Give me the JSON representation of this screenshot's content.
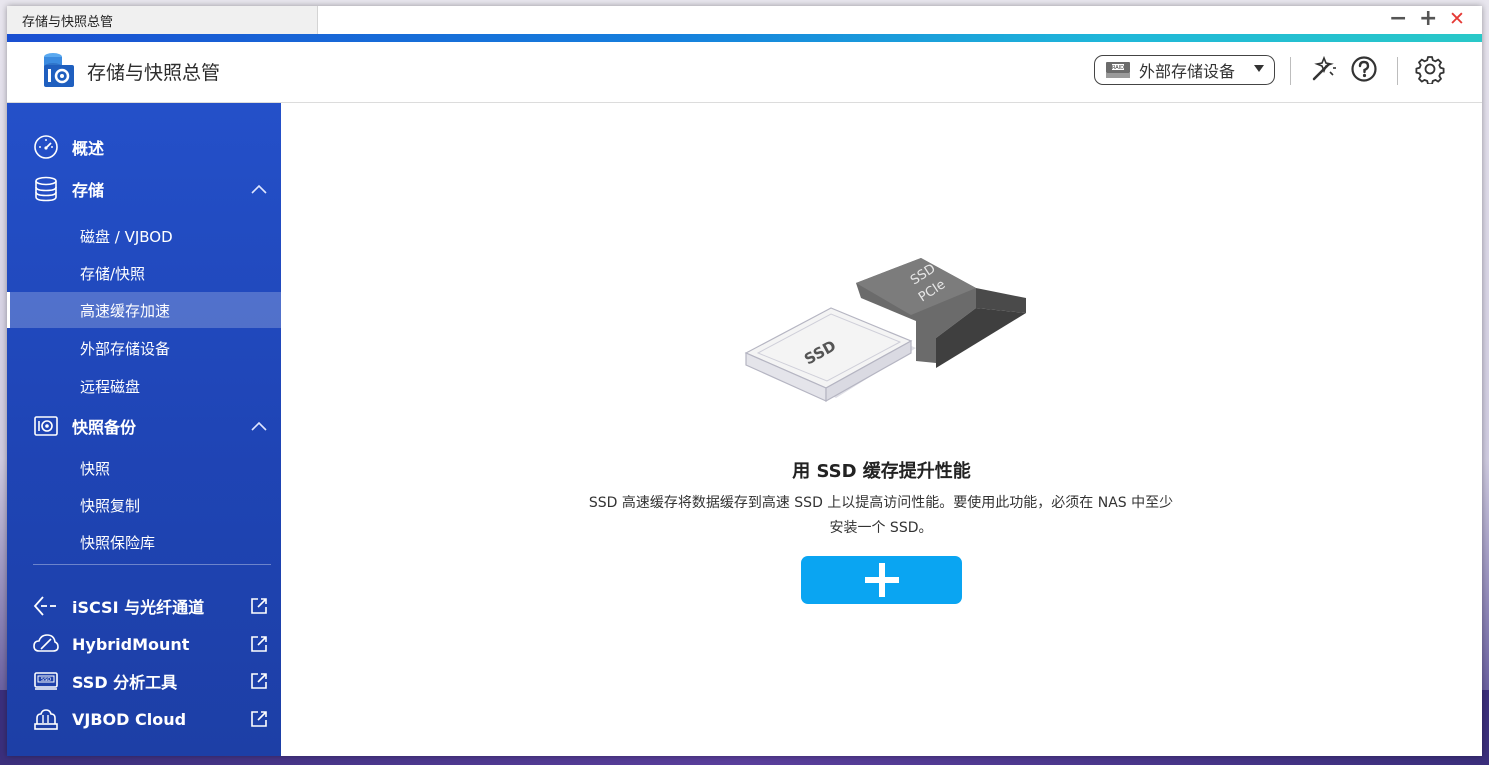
{
  "window": {
    "tab_title": "存储与快照总管",
    "controls": {
      "minimize": "−",
      "maximize": "+",
      "close": "✕"
    }
  },
  "header": {
    "app_title": "存储与快照总管",
    "device_selector": {
      "value": "外部存储设备",
      "icon": "raid-icon"
    },
    "icons": [
      "magic-wand-icon",
      "help-icon",
      "settings-icon"
    ]
  },
  "sidebar": {
    "items": [
      {
        "label": "概述",
        "icon": "dashboard-icon"
      },
      {
        "label": "存储",
        "icon": "database-icon",
        "expanded": true
      },
      {
        "label": "磁盘 / VJBOD"
      },
      {
        "label": "存储/快照"
      },
      {
        "label": "高速缓存加速",
        "selected": true
      },
      {
        "label": "外部存储设备"
      },
      {
        "label": "远程磁盘"
      },
      {
        "label": "快照备份",
        "icon": "camera-icon",
        "expanded": true
      },
      {
        "label": "快照"
      },
      {
        "label": "快照复制"
      },
      {
        "label": "快照保险库"
      }
    ],
    "external_links": [
      {
        "label": "iSCSI 与光纤通道",
        "icon": "iscsi-icon"
      },
      {
        "label": "HybridMount",
        "icon": "cloud-icon"
      },
      {
        "label": "SSD 分析工具",
        "icon": "ssd-icon"
      },
      {
        "label": "VJBOD Cloud",
        "icon": "vjbod-cloud-icon"
      }
    ]
  },
  "main": {
    "illustration": {
      "ssd_label": "SSD",
      "pcie_label_1": "SSD",
      "pcie_label_2": "PCIe"
    },
    "title": "用 SSD 缓存提升性能",
    "description_line1": "SSD 高速缓存将数据缓存到高速 SSD 上以提高访问性能。要使用此功能，必须在 NAS 中至少",
    "description_line2": "安装一个 SSD。",
    "add_button_icon": "plus-icon"
  },
  "colors": {
    "accent": "#0aa5f2",
    "sidebar_top": "#2450c9",
    "sidebar_bottom": "#1d3fa6",
    "close": "#e53935"
  }
}
